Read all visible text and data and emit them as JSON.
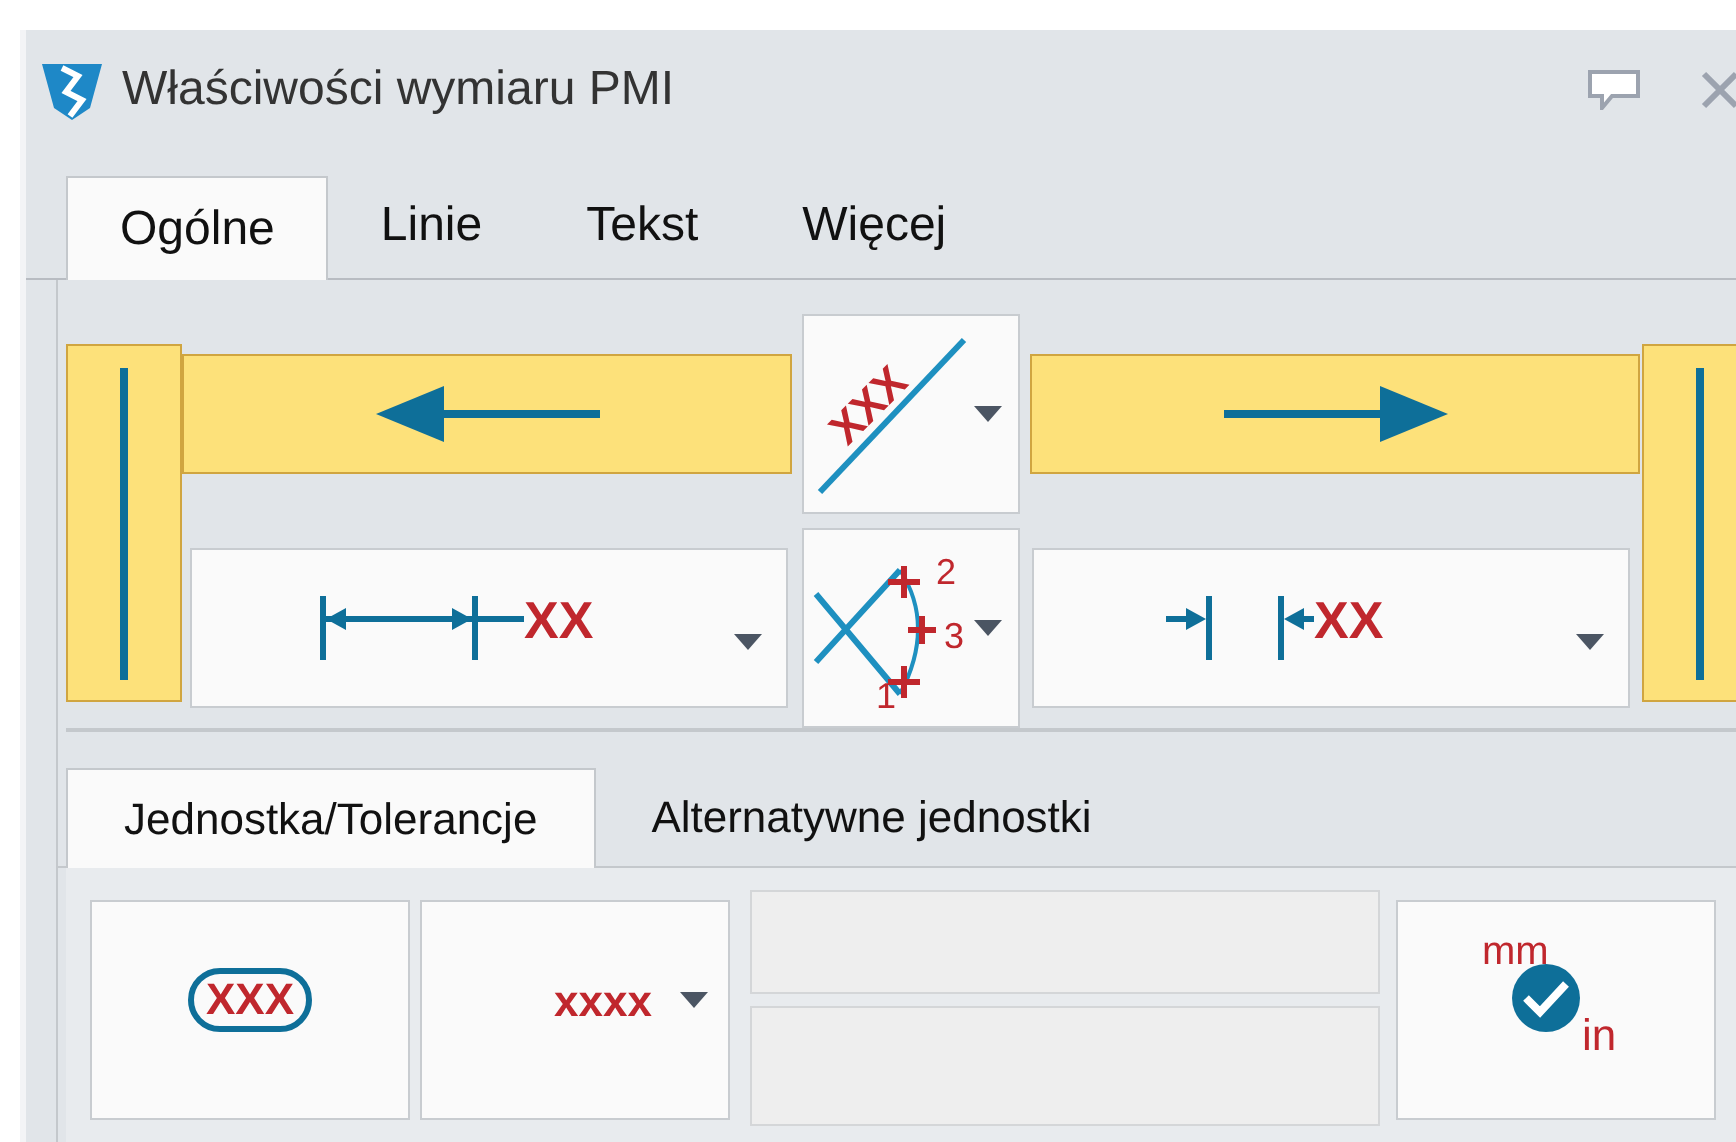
{
  "window": {
    "title": "Właściwości wymiaru PMI"
  },
  "tabs": [
    {
      "label": "Ogólne",
      "selected": true
    },
    {
      "label": "Linie",
      "selected": false
    },
    {
      "label": "Tekst",
      "selected": false
    },
    {
      "label": "Więcej",
      "selected": false
    }
  ],
  "arrows": [
    {
      "kind": "left",
      "selected": true
    },
    {
      "kind": "right",
      "selected": true
    }
  ],
  "text_orientation": {
    "label": "XXX"
  },
  "left_extension": {
    "label": "XX"
  },
  "arrow_points": {
    "labels": [
      "2",
      "3",
      "1"
    ]
  },
  "right_extension": {
    "label": "XX"
  },
  "sub_tabs": [
    {
      "label": "Jednostka/Tolerancje",
      "selected": true
    },
    {
      "label": "Alternatywne jednostki",
      "selected": false
    }
  ],
  "units": {
    "format": "XXX",
    "value": "xxxx",
    "primary_unit": "mm",
    "secondary_unit": "in"
  }
}
